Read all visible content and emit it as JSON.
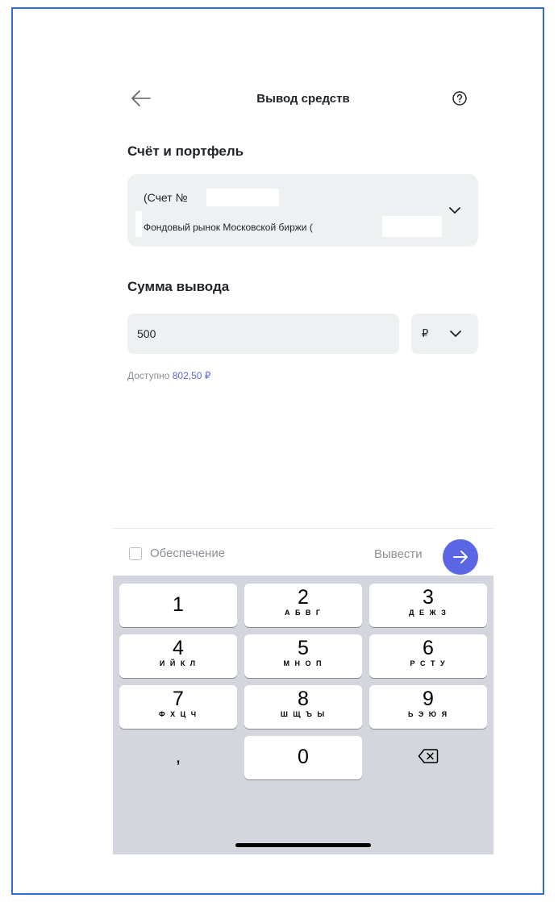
{
  "header": {
    "title": "Вывод средств"
  },
  "account_section": {
    "title": "Счёт и портфель",
    "account_number_label": "(Счет №",
    "market": "Фондовый рынок Московской биржи ("
  },
  "amount_section": {
    "title": "Сумма вывода",
    "amount_value": "500",
    "currency_symbol": "₽",
    "available_label": "Доступно",
    "available_value": "802,50 ₽"
  },
  "footer": {
    "checkbox_label": "Обеспечение",
    "submit_label": "Вывести"
  },
  "keyboard": {
    "keys": [
      {
        "digit": "1",
        "letters": ""
      },
      {
        "digit": "2",
        "letters": "А Б В Г"
      },
      {
        "digit": "3",
        "letters": "Д Е Ж З"
      },
      {
        "digit": "4",
        "letters": "И Й К Л"
      },
      {
        "digit": "5",
        "letters": "М Н О П"
      },
      {
        "digit": "6",
        "letters": "Р С Т У"
      },
      {
        "digit": "7",
        "letters": "Ф Х Ц Ч"
      },
      {
        "digit": "8",
        "letters": "Ш Щ Ъ Ы"
      },
      {
        "digit": "9",
        "letters": "Ь Э Ю Я"
      }
    ],
    "comma": ",",
    "zero": "0"
  },
  "colors": {
    "accent": "#5b66e4",
    "field_background": "#eef1f2",
    "keyboard_background": "#d3d6dc",
    "frame_border": "#2f6ed8"
  },
  "icons": {
    "back": "arrow-left-icon",
    "help": "question-circle-icon",
    "dropdown": "chevron-down-icon",
    "submit": "arrow-right-icon",
    "backspace": "backspace-icon"
  }
}
